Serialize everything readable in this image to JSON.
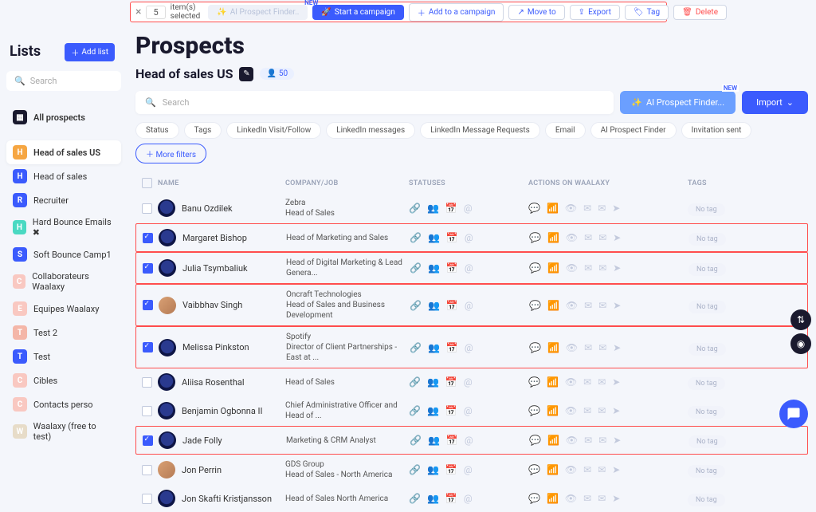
{
  "topbar": {
    "count": "5",
    "selected_label": "item(s) selected",
    "ai_finder": "AI Prospect Finder..",
    "new_badge": "NEW",
    "start_campaign": "Start a campaign",
    "add_to_campaign": "Add to a campaign",
    "move_to": "Move to",
    "export": "Export",
    "tag": "Tag",
    "delete": "Delete"
  },
  "sidebar": {
    "title": "Lists",
    "add_list": "Add list",
    "search_placeholder": "Search",
    "all_prospects": "All prospects",
    "items": [
      {
        "letter": "H",
        "label": "Head of sales US",
        "color": "#f6a642",
        "active": true
      },
      {
        "letter": "H",
        "label": "Head of sales",
        "color": "#3b5bfd"
      },
      {
        "letter": "R",
        "label": "Recruiter",
        "color": "#3b5bfd"
      },
      {
        "letter": "H",
        "label": "Hard Bounce Emails ✖",
        "color": "#4ad9c2"
      },
      {
        "letter": "S",
        "label": "Soft Bounce Camp1",
        "color": "#3b5bfd"
      },
      {
        "letter": "C",
        "label": "Collaborateurs Waalaxy",
        "color": "#f9c8c1"
      },
      {
        "letter": "E",
        "label": "Equipes Waalaxy",
        "color": "#f9c8c1"
      },
      {
        "letter": "T",
        "label": "Test 2",
        "color": "#f4b6a8"
      },
      {
        "letter": "T",
        "label": "Test",
        "color": "#3b5bfd"
      },
      {
        "letter": "C",
        "label": "Cibles",
        "color": "#f9c8c1"
      },
      {
        "letter": "C",
        "label": "Contacts perso",
        "color": "#f9c8c1"
      },
      {
        "letter": "W",
        "label": "Waalaxy (free to test)",
        "color": "#e7dcc8"
      }
    ]
  },
  "header": {
    "page_title": "Prospects",
    "list_name": "Head of sales US",
    "member_count": "50",
    "search_placeholder": "Search",
    "ai_finder": "AI Prospect Finder...",
    "new_badge": "NEW",
    "import": "Import"
  },
  "filters": [
    "Status",
    "Tags",
    "LinkedIn Visit/Follow",
    "LinkedIn messages",
    "LinkedIn Message Requests",
    "Email",
    "AI Prospect Finder",
    "Invitation sent"
  ],
  "more_filters": "More filters",
  "columns": {
    "name": "NAME",
    "company": "COMPANY/JOB",
    "statuses": "STATUSES",
    "actions": "ACTIONS ON WAALAXY",
    "tags": "TAGS"
  },
  "no_tag": "No tag",
  "rows": [
    {
      "checked": false,
      "hl": false,
      "name": "Banu Ozdilek",
      "line1": "Zebra",
      "line2": "Head of Sales",
      "photo": false
    },
    {
      "checked": true,
      "hl": true,
      "name": "Margaret Bishop",
      "line1": "",
      "line2": "Head of Marketing and Sales",
      "photo": false
    },
    {
      "checked": true,
      "hl": true,
      "name": "Julia Tsymbaliuk",
      "line1": "",
      "line2": "Head of Digital Marketing & Lead Genera...",
      "photo": false
    },
    {
      "checked": true,
      "hl": true,
      "name": "Vaibbhav Singh",
      "line1": "Oncraft Technologies",
      "line2": "Head of Sales and Business Development",
      "photo": true
    },
    {
      "checked": true,
      "hl": true,
      "name": "Melissa Pinkston",
      "line1": "Spotify",
      "line2": "Director of Client Partnerships - East at ...",
      "photo": false
    },
    {
      "checked": false,
      "hl": false,
      "name": "Aliisa Rosenthal",
      "line1": "",
      "line2": "Head of Sales",
      "photo": false
    },
    {
      "checked": false,
      "hl": false,
      "name": "Benjamin Ogbonna II",
      "line1": "",
      "line2": "Chief Administrative Officer and Head of ...",
      "photo": false
    },
    {
      "checked": true,
      "hl": true,
      "name": "Jade Folly",
      "line1": "",
      "line2": "Marketing & CRM Analyst",
      "photo": false
    },
    {
      "checked": false,
      "hl": false,
      "name": "Jon Perrin",
      "line1": "GDS Group",
      "line2": "Head of Sales - North America",
      "photo": true
    },
    {
      "checked": false,
      "hl": false,
      "name": "Jon Skafti Kristjansson",
      "line1": "",
      "line2": "Head of Sales North America",
      "photo": false
    }
  ]
}
